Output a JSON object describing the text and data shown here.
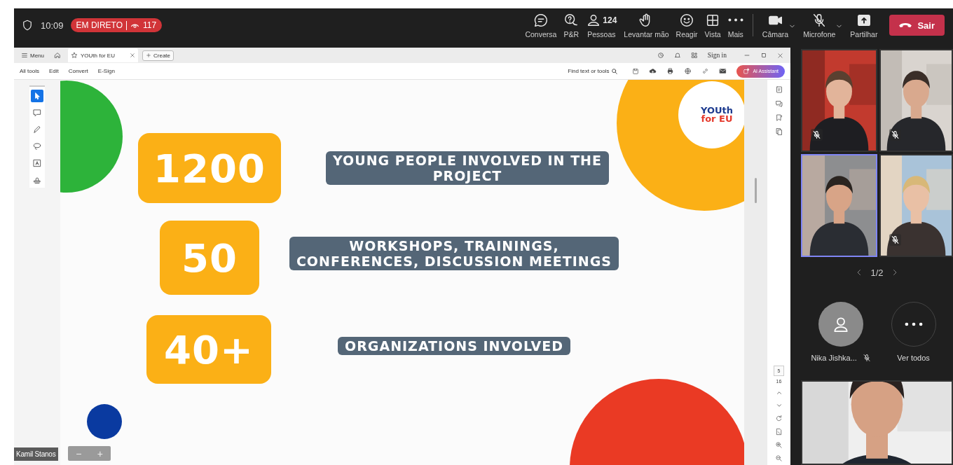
{
  "meeting": {
    "time": "10:09",
    "live_label": "EM DIRETO",
    "viewers": "117"
  },
  "toolbar": [
    {
      "kind": "chat",
      "label": "Conversa"
    },
    {
      "kind": "qa",
      "label": "P&R"
    },
    {
      "kind": "people",
      "label": "Pessoas",
      "count": "124"
    },
    {
      "kind": "hand",
      "label": "Levantar mão"
    },
    {
      "kind": "react",
      "label": "Reagir"
    },
    {
      "kind": "view",
      "label": "Vista"
    },
    {
      "kind": "more",
      "label": "Mais"
    },
    {
      "kind": "camera",
      "label": "Câmara"
    },
    {
      "kind": "mic",
      "label": "Microfone",
      "muted": true
    },
    {
      "kind": "share",
      "label": "Partilhar"
    }
  ],
  "leave_button": "Sair",
  "shared_screen": {
    "tab_bar": {
      "menu": "Menu",
      "tab": "YOUth for EU",
      "create": "Create",
      "sign_in": "Sign in"
    },
    "menu": [
      "All tools",
      "Edit",
      "Convert",
      "E-Sign"
    ],
    "search": "Find text or tools",
    "ai_button": "AI Assistant",
    "tools": [
      {
        "kind": "select",
        "selected": true
      },
      {
        "kind": "comment",
        "selected": false
      },
      {
        "kind": "pen",
        "selected": false
      },
      {
        "kind": "lasso",
        "selected": false
      },
      {
        "kind": "text",
        "selected": false
      },
      {
        "kind": "stamp",
        "selected": false
      }
    ],
    "slide": {
      "logo": [
        "YOUth",
        "for EU"
      ],
      "stats": [
        {
          "number": "1200",
          "label": "YOUNG PEOPLE INVOLVED IN THE\nPROJECT"
        },
        {
          "number": "50",
          "label": "WORKSHOPS, TRAININGS,\nCONFERENCES, DISCUSSION MEETINGS"
        },
        {
          "number": "40+",
          "label": "ORGANIZATIONS INVOLVED"
        }
      ]
    },
    "page": "5",
    "page_count": "16",
    "presenter": "Kamil Stanos",
    "zoom": [
      "−",
      "+"
    ]
  },
  "participants": {
    "tiles": [
      {
        "kind": "picture",
        "muted": true,
        "highlighted": false
      },
      {
        "kind": "picture",
        "muted": true,
        "highlighted": false
      },
      {
        "kind": "picture",
        "muted": false,
        "highlighted": true
      },
      {
        "kind": "picture",
        "muted": true,
        "highlighted": false
      }
    ],
    "pager": "1/2",
    "others": [
      {
        "kind": "avatar",
        "name": "Nika Jishka...",
        "muted": true
      },
      {
        "kind": "more",
        "name": "Ver todos",
        "muted": false
      }
    ],
    "featured": {
      "kind": "picture",
      "muted": false,
      "highlighted": false
    }
  }
}
